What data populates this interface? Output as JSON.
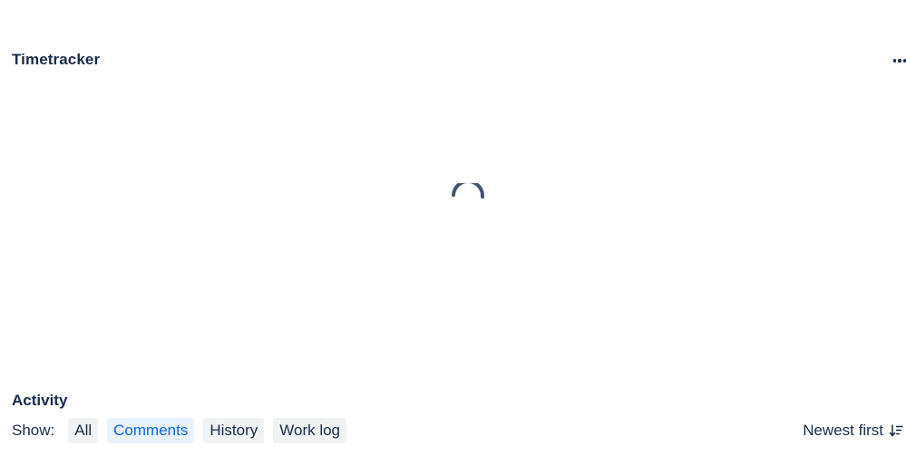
{
  "timetracker": {
    "title": "Timetracker",
    "menu_icon": "more-horizontal-icon",
    "loading_icon": "loading-spinner-icon"
  },
  "activity": {
    "title": "Activity",
    "show_label": "Show:",
    "filters": [
      "All",
      "Comments",
      "History",
      "Work log"
    ],
    "selected_filter": "Comments",
    "sort_label": "Newest first",
    "sort_icon": "sort-descending-icon"
  },
  "colors": {
    "text": "#172b4d",
    "selected_text": "#0c66e4",
    "selected_bg": "#e9f2ff",
    "button_bg": "#f1f2f4",
    "spinner": "#44546f"
  }
}
